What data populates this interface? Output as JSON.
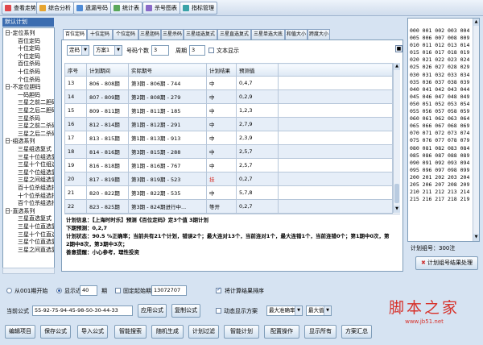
{
  "toolbar": {
    "items": [
      "查看走势",
      "综合分析",
      "遗漏号码",
      "统计表",
      "杀号图表",
      "指标管理"
    ]
  },
  "left": {
    "header": "默认计划",
    "tree": [
      "日-定位系列",
      "百位定码",
      "十位定码",
      "个位定码",
      "百位杀码",
      "十位杀码",
      "个位杀码",
      "日-不定位胆码",
      "一码胆码",
      "三星之前二胆码",
      "三星之后二胆码",
      "三星杀码",
      "三星之前二杀码",
      "三星之后二杀码",
      "日-组选系列",
      "三星组选复式",
      "三星十位组选复",
      "三星十个位组选",
      "三星个位组选复",
      "三星之间组选复",
      "百十位杀组选拍",
      "十个位杀组选拍",
      "百个位杀组选拍",
      "日-直选系列",
      "三星直选复式",
      "三星十位直选复",
      "三星十个位直选",
      "三星个位直选复",
      "三星之间直选复"
    ]
  },
  "tabs": [
    "百位定码",
    "十位定码",
    "个位定码",
    "三星胆码",
    "三星杀码",
    "三星组选复式",
    "三星直选复式",
    "三星单选大底",
    "和值大小",
    "跨度大小"
  ],
  "filters": {
    "type": "定码",
    "scheme": "方案1",
    "count_label": "号码个数",
    "count": "3",
    "period_label": "周期",
    "period": "3",
    "text_show": "文本显示"
  },
  "table": {
    "headers": [
      "序号",
      "计划期间",
      "实际期号",
      "计划结果",
      "预测值"
    ],
    "rows": [
      [
        "13",
        "806 - 808期",
        "第3期 - 806期 - 744",
        "中",
        "0,4,7"
      ],
      [
        "14",
        "807 - 809期",
        "第2期 - 808期 - 279",
        "中",
        "0,2,9"
      ],
      [
        "15",
        "809 - 811期",
        "第1期 - 811期 - 185",
        "中",
        "1,2,3"
      ],
      [
        "16",
        "812 - 814期",
        "第1期 - 812期 - 291",
        "中",
        "2,7,9"
      ],
      [
        "17",
        "813 - 815期",
        "第1期 - 813期 - 913",
        "中",
        "2,3,9"
      ],
      [
        "18",
        "814 - 816期",
        "第3期 - 815期 - 288",
        "中",
        "2,5,7"
      ],
      [
        "19",
        "816 - 818期",
        "第1期 - 816期 - 767",
        "中",
        "2,5,7"
      ],
      [
        "20",
        "817 - 819期",
        "第3期 - 819期 - 523",
        "挂",
        "0,2,7"
      ],
      [
        "21",
        "820 - 822期",
        "第3期 - 822期 - 535",
        "中",
        "5,7,8"
      ],
      [
        "22",
        "823 - 825期",
        "第3期 - 824期进行中...",
        "等开",
        "0,2,7"
      ]
    ]
  },
  "info": {
    "line1": "计划信息：【上海时时乐】预测《百位定码》定3个值 3期计划",
    "line2": "下期预测：0,2,7",
    "line3": "计划状态：90.5 %正确率；当前共有21个计划，错误2个；最大连对13个，当前连对1个，最大连错1个，当前连错0个；第1期中0次，第2期中8次，第3期中3次；",
    "line4": "善意提醒：小心参考，理性投资"
  },
  "numbers": {
    "lines": [
      "000 001 002 003 004",
      "005 006 007 008 009",
      "010 011 012 013 014",
      "015 016 017 018 019",
      "020 021 022 023 024",
      "025 026 027 028 029",
      "030 031 032 033 034",
      "035 036 037 038 039",
      "040 041 042 043 044",
      "045 046 047 048 049",
      "050 051 052 053 054",
      "055 056 057 058 059",
      "060 061 062 063 064",
      "065 066 067 068 069",
      "070 071 072 073 074",
      "075 076 077 078 079",
      "080 081 082 083 084",
      "085 086 087 088 089",
      "090 091 092 093 094",
      "095 096 097 098 099",
      "200 201 202 203 204",
      "205 206 207 208 209",
      "210 211 212 213 214",
      "215 216 217 218 219"
    ],
    "count_text": "计划组号：300注",
    "process_btn": "计划组号结果处理"
  },
  "bottom": {
    "from_label": "从001期开始",
    "recent_label": "显示近",
    "recent_value": "40",
    "recent_unit": "期",
    "fixed_label": "固定起始期",
    "fixed_value": "13072707",
    "reverse_label": "将计算结果排序",
    "formula_label": "当前公式",
    "formula_value": "55-92-75-94-45-98-50-30-44-33",
    "apply_btn": "应用公式",
    "copy_btn": "复制公式",
    "dynamic_label": "动态显示方案",
    "max_rate": "最大准确率",
    "max_val": "最大值",
    "buttons": [
      "编辑项目",
      "保存公式",
      "导入公式",
      "智能搜索",
      "随机生成",
      "计划过滤",
      "智能计划",
      "配置操作",
      "显示所有",
      "方案汇总"
    ]
  },
  "watermark": {
    "title": "脚本之家",
    "url": "www.jb51.net"
  }
}
